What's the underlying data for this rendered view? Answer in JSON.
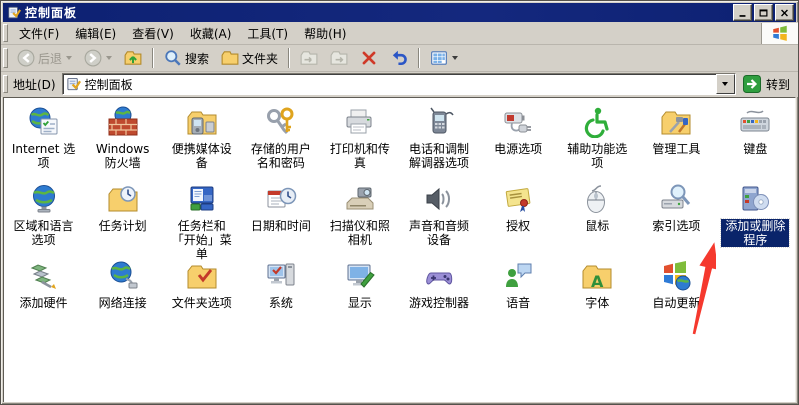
{
  "window": {
    "title": "控制面板"
  },
  "menu_bar": {
    "items": [
      "文件(F)",
      "编辑(E)",
      "查看(V)",
      "收藏(A)",
      "工具(T)",
      "帮助(H)"
    ]
  },
  "toolbar": {
    "buttons": [
      {
        "name": "back",
        "icon": "back-circle",
        "label": "后退",
        "disabled": true,
        "caret": true
      },
      {
        "name": "forward",
        "icon": "forward-circle",
        "disabled": true,
        "caret": true
      },
      {
        "name": "up",
        "icon": "folder-up"
      },
      {
        "sep": true
      },
      {
        "name": "search",
        "icon": "magnifier",
        "label": "搜索"
      },
      {
        "name": "folders",
        "icon": "folder",
        "label": "文件夹"
      },
      {
        "sep": true
      },
      {
        "name": "move-to",
        "icon": "folder-move",
        "disabled": true
      },
      {
        "name": "copy-to",
        "icon": "folder-copy",
        "disabled": true
      },
      {
        "name": "delete",
        "icon": "red-x"
      },
      {
        "name": "undo",
        "icon": "undo"
      },
      {
        "sep": true
      },
      {
        "name": "views",
        "icon": "views",
        "caret": true
      }
    ]
  },
  "address_bar": {
    "label": "地址(D)",
    "value": "控制面板",
    "go_label": "转到"
  },
  "control_panel": {
    "items": [
      {
        "label": "Internet 选项",
        "icon": "internet-options"
      },
      {
        "label": "Windows 防火墙",
        "icon": "windows-firewall"
      },
      {
        "label": "便携媒体设备",
        "icon": "portable-media"
      },
      {
        "label": "存储的用户名和密码",
        "icon": "stored-passwords"
      },
      {
        "label": "打印机和传真",
        "icon": "printers-faxes"
      },
      {
        "label": "电话和调制解调器选项",
        "icon": "phone-modem"
      },
      {
        "label": "电源选项",
        "icon": "power-options"
      },
      {
        "label": "辅助功能选项",
        "icon": "accessibility"
      },
      {
        "label": "管理工具",
        "icon": "admin-tools"
      },
      {
        "label": "键盘",
        "icon": "keyboard"
      },
      {
        "label": "区域和语言选项",
        "icon": "regional-language"
      },
      {
        "label": "任务计划",
        "icon": "scheduled-tasks"
      },
      {
        "label": "任务栏和「开始」菜单",
        "icon": "taskbar-start-menu"
      },
      {
        "label": "日期和时间",
        "icon": "date-time"
      },
      {
        "label": "扫描仪和照相机",
        "icon": "scanners-cameras"
      },
      {
        "label": "声音和音频设备",
        "icon": "sounds-audio"
      },
      {
        "label": "授权",
        "icon": "licensing"
      },
      {
        "label": "鼠标",
        "icon": "mouse"
      },
      {
        "label": "索引选项",
        "icon": "indexing-options"
      },
      {
        "label": "添加或删除程序",
        "icon": "add-remove-programs",
        "selected": true
      },
      {
        "label": "添加硬件",
        "icon": "add-hardware"
      },
      {
        "label": "网络连接",
        "icon": "network-connections"
      },
      {
        "label": "文件夹选项",
        "icon": "folder-options"
      },
      {
        "label": "系统",
        "icon": "system"
      },
      {
        "label": "显示",
        "icon": "display"
      },
      {
        "label": "游戏控制器",
        "icon": "game-controllers"
      },
      {
        "label": "语音",
        "icon": "speech"
      },
      {
        "label": "字体",
        "icon": "fonts"
      },
      {
        "label": "自动更新",
        "icon": "automatic-updates"
      }
    ]
  },
  "annotation": {
    "arrow_color": "#f5392e"
  },
  "colors": {
    "titlebar": "#0d2172",
    "selection": "#0a246a",
    "chrome": "#d4d0c8",
    "content_bg": "#ffffff",
    "go_button": "#2f9e3f"
  }
}
